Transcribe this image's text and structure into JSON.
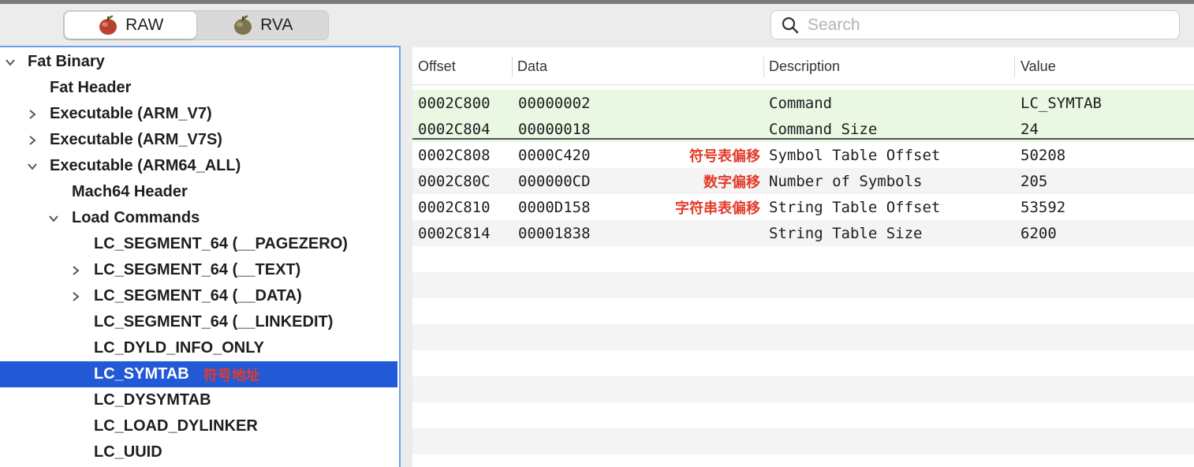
{
  "toolbar": {
    "modes": [
      {
        "label": "RAW",
        "active": true
      },
      {
        "label": "RVA",
        "active": false
      }
    ],
    "search": {
      "placeholder": "Search",
      "value": ""
    }
  },
  "tree": [
    {
      "label": "Fat Binary",
      "level": 0,
      "expander": "open"
    },
    {
      "label": "Fat Header",
      "level": 1,
      "expander": "none"
    },
    {
      "label": "Executable  (ARM_V7)",
      "level": 1,
      "expander": "closed"
    },
    {
      "label": "Executable  (ARM_V7S)",
      "level": 1,
      "expander": "closed"
    },
    {
      "label": "Executable  (ARM64_ALL)",
      "level": 1,
      "expander": "open"
    },
    {
      "label": "Mach64 Header",
      "level": 2,
      "expander": "none"
    },
    {
      "label": "Load Commands",
      "level": 2,
      "expander": "open"
    },
    {
      "label": "LC_SEGMENT_64 (__PAGEZERO)",
      "level": 3,
      "expander": "none"
    },
    {
      "label": "LC_SEGMENT_64 (__TEXT)",
      "level": 3,
      "expander": "closed"
    },
    {
      "label": "LC_SEGMENT_64 (__DATA)",
      "level": 3,
      "expander": "closed"
    },
    {
      "label": "LC_SEGMENT_64 (__LINKEDIT)",
      "level": 3,
      "expander": "none"
    },
    {
      "label": "LC_DYLD_INFO_ONLY",
      "level": 3,
      "expander": "none"
    },
    {
      "label": "LC_SYMTAB",
      "level": 3,
      "expander": "none",
      "selected": true,
      "note": "符号地址"
    },
    {
      "label": "LC_DYSYMTAB",
      "level": 3,
      "expander": "none"
    },
    {
      "label": "LC_LOAD_DYLINKER",
      "level": 3,
      "expander": "none"
    },
    {
      "label": "LC_UUID",
      "level": 3,
      "expander": "none"
    }
  ],
  "table": {
    "columns": [
      "Offset",
      "Data",
      "Description",
      "Value"
    ],
    "rows": [
      {
        "offset": "0002C800",
        "data": "00000002",
        "note": "",
        "description": "Command",
        "value": "LC_SYMTAB",
        "style": "highlight"
      },
      {
        "offset": "0002C804",
        "data": "00000018",
        "note": "",
        "description": "Command Size",
        "value": "24",
        "style": "highlight"
      },
      {
        "offset": "0002C808",
        "data": "0000C420",
        "note": "符号表偏移",
        "description": "Symbol Table Offset",
        "value": "50208",
        "style": "plain"
      },
      {
        "offset": "0002C80C",
        "data": "000000CD",
        "note": "数字偏移",
        "description": "Number of Symbols",
        "value": "205",
        "style": "alt"
      },
      {
        "offset": "0002C810",
        "data": "0000D158",
        "note": "字符串表偏移",
        "description": "String Table Offset",
        "value": "53592",
        "style": "plain"
      },
      {
        "offset": "0002C814",
        "data": "00001838",
        "note": "",
        "description": "String Table Size",
        "value": "6200",
        "style": "alt"
      }
    ]
  },
  "colors": {
    "selection": "#2159d6",
    "annotation": "#e33b2c",
    "highlight_row": "#e9f7e3",
    "focus_border": "#6f9fe6"
  }
}
